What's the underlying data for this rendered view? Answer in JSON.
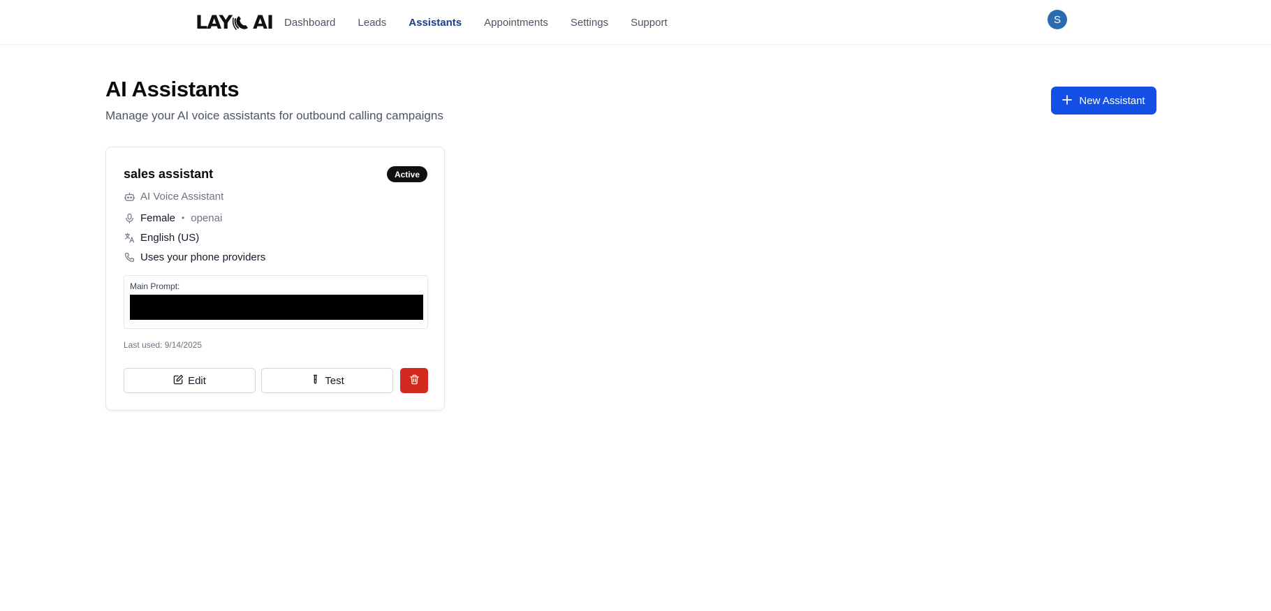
{
  "header": {
    "logo_left": "LAY",
    "logo_right": "AI",
    "nav": [
      {
        "label": "Dashboard",
        "active": false
      },
      {
        "label": "Leads",
        "active": false
      },
      {
        "label": "Assistants",
        "active": true
      },
      {
        "label": "Appointments",
        "active": false
      },
      {
        "label": "Settings",
        "active": false
      },
      {
        "label": "Support",
        "active": false
      }
    ],
    "avatar_initial": "S"
  },
  "page": {
    "title": "AI Assistants",
    "subtitle": "Manage your AI voice assistants for outbound calling campaigns",
    "new_button_label": "New Assistant"
  },
  "assistant": {
    "name": "sales assistant",
    "status": "Active",
    "type": "AI Voice Assistant",
    "voice_gender": "Female",
    "voice_provider": "openai",
    "language": "English (US)",
    "phone_providers": "Uses your phone providers",
    "prompt_label": "Main Prompt:",
    "last_used": "Last used: 9/14/2025",
    "edit_label": "Edit",
    "test_label": "Test"
  },
  "colors": {
    "primary": "#1450e6",
    "nav_active": "#1e3a8a",
    "avatar": "#2b6cb0",
    "badge": "#111111",
    "danger": "#d22a1e"
  },
  "icons": {
    "assistant_type": "bot-icon",
    "voice": "microphone-icon",
    "language": "language-icon",
    "phone": "phone-icon",
    "edit": "pencil-square-icon",
    "test": "test-tube-icon",
    "delete": "trash-icon",
    "new": "plus-icon"
  }
}
